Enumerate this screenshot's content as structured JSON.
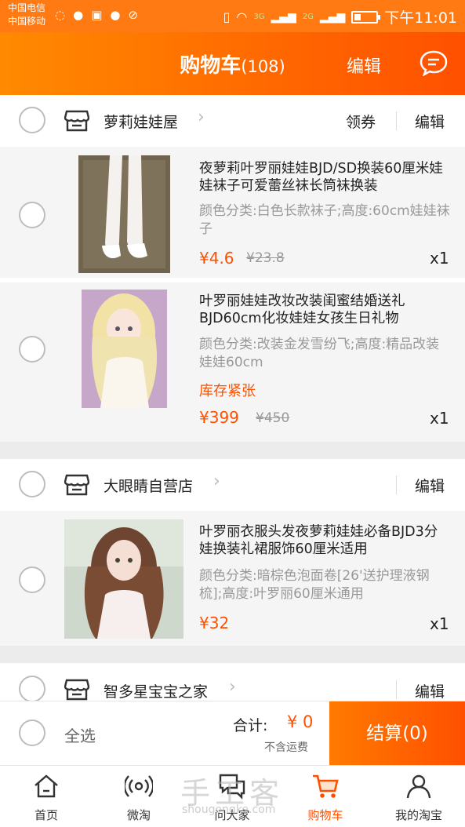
{
  "status_bar": {
    "carrier_1": "中国电信",
    "carrier_2": "中国移动",
    "time": "下午11:01",
    "net_1": "3G",
    "net_2": "2G"
  },
  "header": {
    "title": "购物车",
    "count": "(108)",
    "edit_label": "编辑",
    "chat_icon": "message-icon"
  },
  "shops": [
    {
      "name": "萝莉娃娃屋",
      "coupon_label": "领券",
      "edit_label": "编辑",
      "items": [
        {
          "title": "夜萝莉叶罗丽娃娃BJD/SD换装60厘米娃娃袜子可爱蕾丝袜长筒袜换装",
          "spec": "颜色分类:白色长款袜子;高度:60cm娃娃袜子",
          "price": "¥4.6",
          "old_price": "¥23.8",
          "qty": "x1"
        },
        {
          "title": "叶罗丽娃娃改妆改装闺蜜结婚送礼BJD60cm化妆娃娃女孩生日礼物",
          "spec": "颜色分类:改装金发雪纷飞;高度:精品改装娃娃60cm",
          "stock": "库存紧张",
          "price": "¥399",
          "old_price": "¥450",
          "qty": "x1"
        }
      ]
    },
    {
      "name": "大眼睛自营店",
      "edit_label": "编辑",
      "items": [
        {
          "title": "叶罗丽衣服头发夜萝莉娃娃必备BJD3分娃换装礼裙服饰60厘米适用",
          "spec": "颜色分类:暗棕色泡面卷[26'送护理液钢梳];高度:叶罗丽60厘米通用",
          "price": "¥32",
          "qty": "x1"
        }
      ]
    },
    {
      "name": "智多星宝宝之家",
      "edit_label": "编辑"
    }
  ],
  "checkout": {
    "select_all": "全选",
    "total_label": "合计:",
    "total_value": "¥ 0",
    "shipping_note": "不含运费",
    "settle_label": "结算(0)"
  },
  "tabbar": {
    "tabs": [
      {
        "label": "首页",
        "icon": "home-icon"
      },
      {
        "label": "微淘",
        "icon": "broadcast-icon"
      },
      {
        "label": "问大家",
        "icon": "chat-bubbles-icon"
      },
      {
        "label": "购物车",
        "icon": "cart-icon"
      },
      {
        "label": "我的淘宝",
        "icon": "person-icon"
      }
    ]
  },
  "watermark": {
    "text": "手工客",
    "url": "shougongke.com"
  },
  "colors": {
    "accent": "#ff5000",
    "header_start": "#ff8a00"
  }
}
